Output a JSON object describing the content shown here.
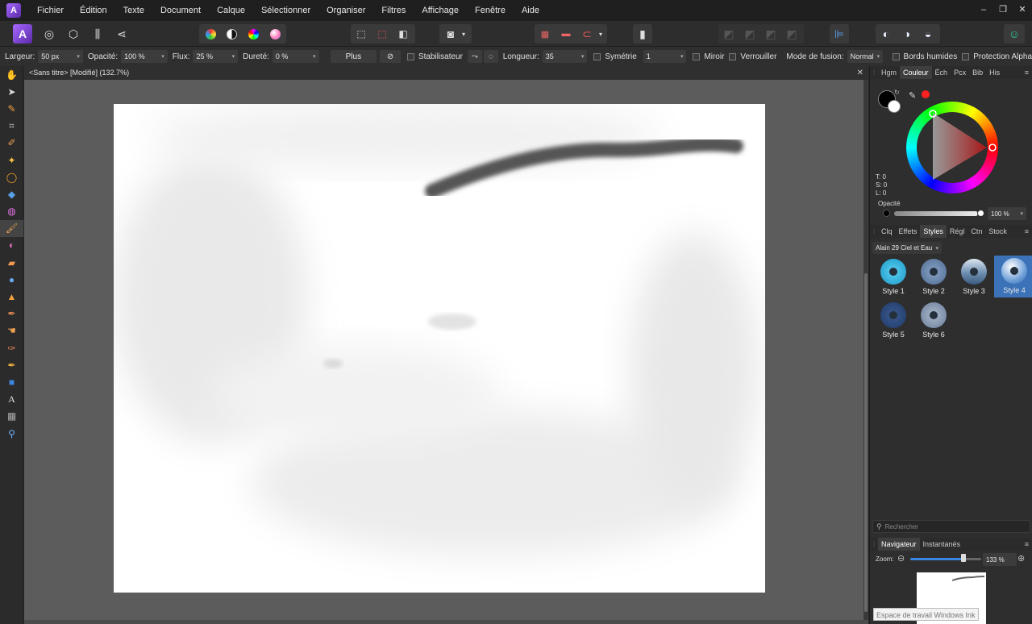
{
  "menu": [
    "Fichier",
    "Édition",
    "Texte",
    "Document",
    "Calque",
    "Sélectionner",
    "Organiser",
    "Filtres",
    "Affichage",
    "Fenêtre",
    "Aide"
  ],
  "window_controls": [
    "–",
    "❐",
    "✕"
  ],
  "context": {
    "width_label": "Largeur:",
    "width_value": "50 px",
    "opacity_label": "Opacité:",
    "opacity_value": "100 %",
    "flow_label": "Flux:",
    "flow_value": "25 %",
    "hardness_label": "Dureté:",
    "hardness_value": "0 %",
    "more_label": "Plus",
    "stabilizer_label": "Stabilisateur",
    "length_label": "Longueur:",
    "length_value": "35",
    "symmetry_label": "Symétrie",
    "symmetry_value": "1",
    "mirror_label": "Miroir",
    "lock_label": "Verrouiller",
    "blend_label": "Mode de fusion:",
    "blend_value": "Normal",
    "wet_edges_label": "Bords humides",
    "alpha_label": "Protection Alpha"
  },
  "document": {
    "tab_title": "<Sans titre> [Modifié] (132.7%)"
  },
  "color_panel": {
    "tabs": [
      "Hgm",
      "Couleur",
      "Éch",
      "Pcx",
      "Bib",
      "His"
    ],
    "active_tab": "Couleur",
    "readouts": [
      "T: 0",
      "S: 0",
      "L: 0"
    ],
    "opacity_label": "Opacité",
    "opacity_value": "100 %"
  },
  "styles_panel": {
    "tabs": [
      "Clq",
      "Effets",
      "Styles",
      "Régl",
      "Ctn",
      "Stock"
    ],
    "active_tab": "Styles",
    "category": "Alain 29 Ciel et Eau",
    "items": [
      "Style 1",
      "Style 2",
      "Style 3",
      "Style 4",
      "Style 5",
      "Style 6"
    ],
    "selected": "Style 4",
    "search_placeholder": "Rechercher"
  },
  "navigator_panel": {
    "tabs": [
      "Navigateur",
      "Instantanés"
    ],
    "active_tab": "Navigateur",
    "zoom_label": "Zoom:",
    "zoom_value": "133 %"
  },
  "tooltip": "Espace de travail Windows Ink",
  "colors": {
    "accent": "#3b72b8",
    "persona": "#8a4fe6",
    "primary_color": "#000000",
    "hue_marker": "#ff2020"
  }
}
